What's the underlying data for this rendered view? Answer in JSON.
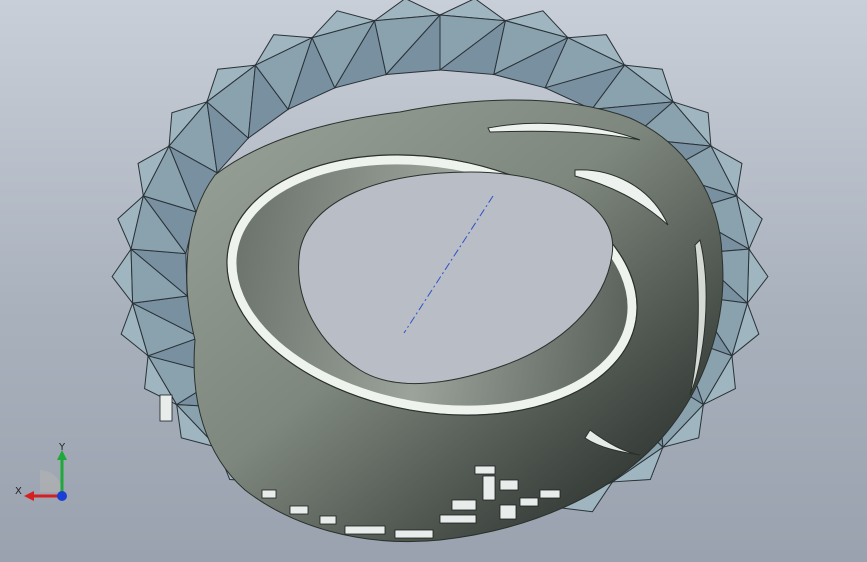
{
  "viewport": {
    "background_top": "#c9cfd8",
    "background_bottom": "#9aa2af"
  },
  "model": {
    "facet_fill": "#8fa8b4",
    "facet_edge": "#2a3238",
    "band_fill": "#7e877e",
    "hole_fill": "#b7bcc3",
    "rim_highlight": "#eef3ee",
    "centerline_color": "#2f52c9"
  },
  "triad": {
    "x_label": "X",
    "y_label": "Y",
    "x_color": "#d42020",
    "y_color": "#20a83a",
    "z_color": "#1a3fd6"
  }
}
